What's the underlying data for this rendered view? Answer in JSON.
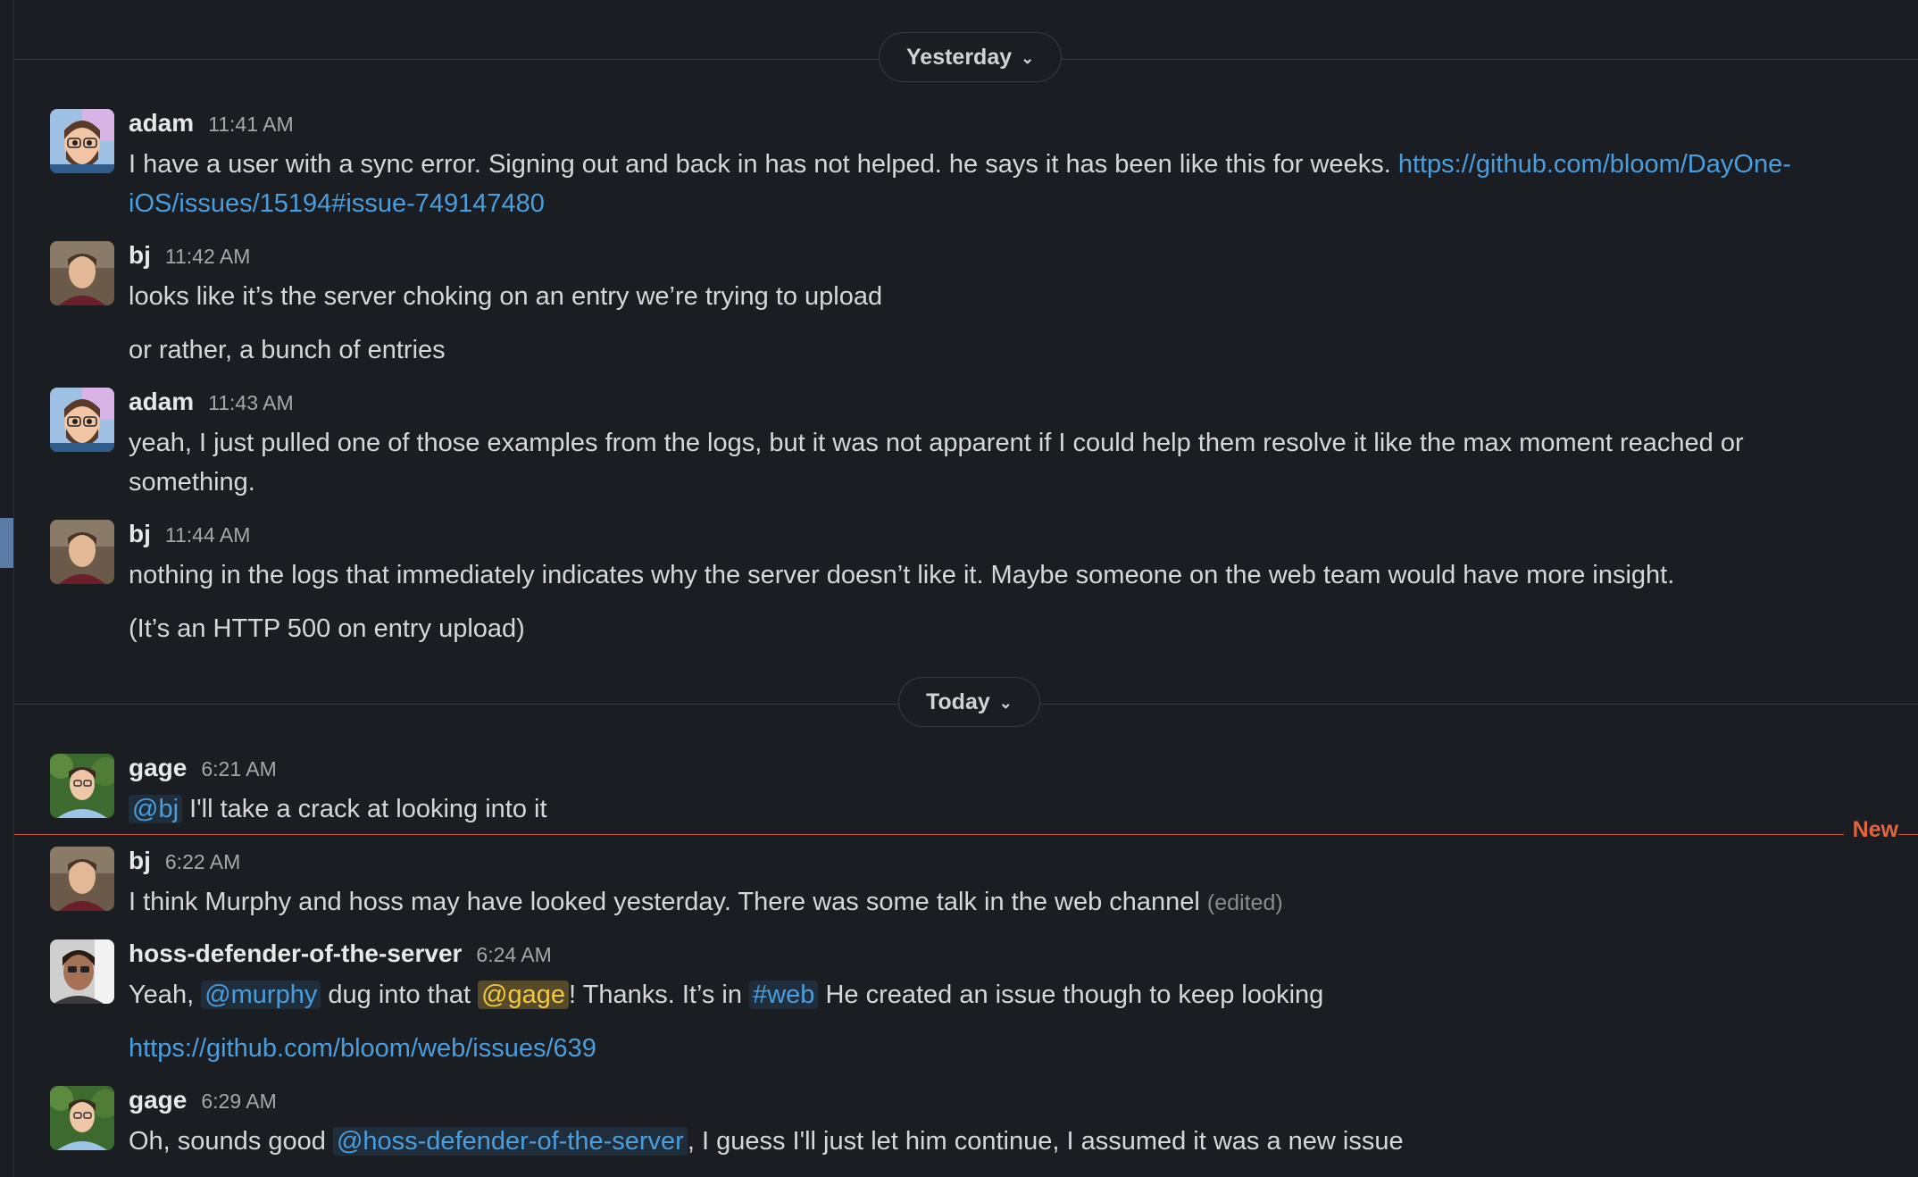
{
  "dividers": {
    "yesterday": "Yesterday",
    "today": "Today"
  },
  "new_marker": "New",
  "messages": [
    {
      "user": "adam",
      "time": "11:41 AM",
      "text": "I have a user with a sync error. Signing out and back in has not helped. he says it has been like this for weeks. ",
      "link": "https://github.com/bloom/DayOne-",
      "link2": "iOS/issues/15194#issue-749147480"
    },
    {
      "user": "bj",
      "time": "11:42 AM",
      "text": "looks like it’s the server choking on an entry we’re trying to upload",
      "followup": "or rather, a bunch of entries"
    },
    {
      "user": "adam",
      "time": "11:43 AM",
      "text": "yeah, I just pulled one of those examples from the logs, but it was not apparent if I could help them resolve it like the max moment reached or",
      "text2": "something."
    },
    {
      "user": "bj",
      "time": "11:44 AM",
      "text": "nothing in the logs that immediately indicates why the server doesn’t like it. Maybe someone on the web team would have more insight.",
      "followup": "(It’s an HTTP 500 on entry upload)"
    },
    {
      "user": "gage",
      "time": "6:21 AM",
      "mention": "@bj",
      "text": " I'll take a crack at looking into it"
    },
    {
      "user": "bj",
      "time": "6:22 AM",
      "text": "I think Murphy and hoss may have looked yesterday. There was some talk in the web channel",
      "edited": "(edited)"
    },
    {
      "user": "hoss-defender-of-the-server",
      "time": "6:24 AM",
      "t1": "Yeah, ",
      "mention1": "@murphy",
      "t2": " dug into that ",
      "mention2": "@gage",
      "t3": "! Thanks. It’s in ",
      "channel": "#web",
      "t4": " He created an issue though to keep looking",
      "followup_link": "https://github.com/bloom/web/issues/639"
    },
    {
      "user": "gage",
      "time": "6:29 AM",
      "t1": "Oh, sounds good ",
      "mention": "@hoss-defender-of-the-server",
      "t2": ", I guess I'll just let him continue, I assumed it was a new issue"
    }
  ]
}
